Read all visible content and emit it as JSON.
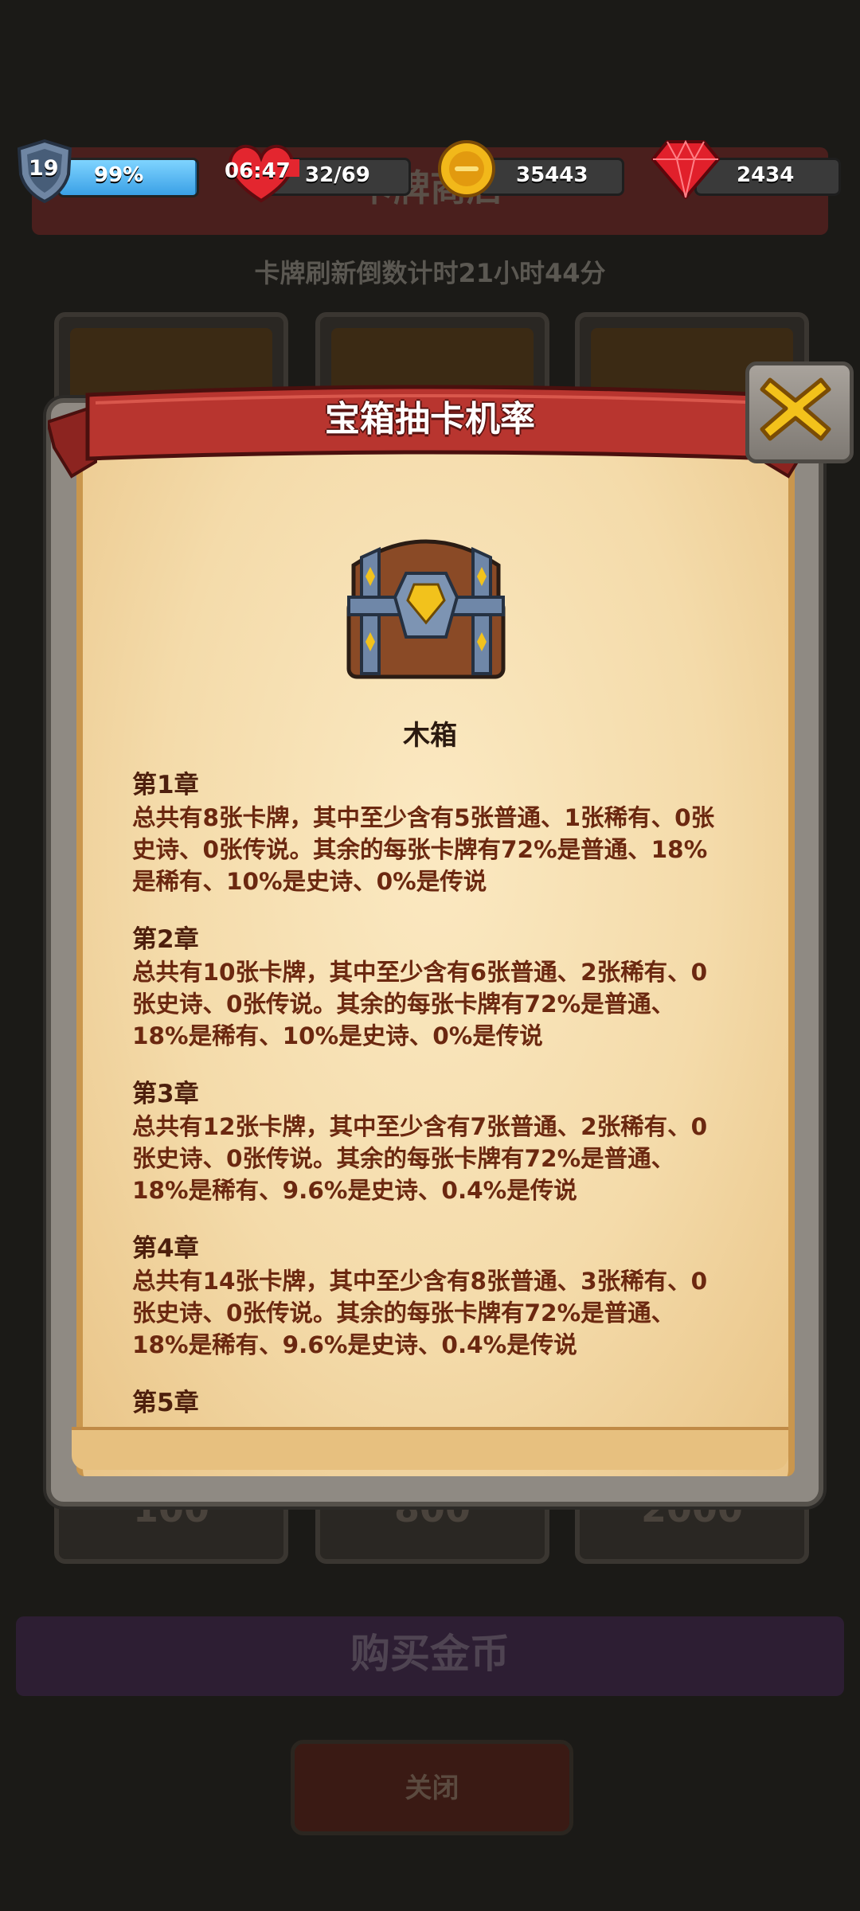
{
  "hud": {
    "level": "19",
    "xp_percent": "99%",
    "xp_fill": 0.99,
    "timer": "06:47",
    "cards": "32/69",
    "coins": "35443",
    "gems": "2434"
  },
  "background": {
    "banner_title": "卡牌商店",
    "countdown": "卡牌刷新倒数计时21小时44分",
    "card_prices": [
      "100",
      "800",
      "2000"
    ],
    "buy_button": "购买金币",
    "close_button": "关闭"
  },
  "dialog": {
    "title": "宝箱抽卡机率",
    "chest_name": "木箱",
    "chapters": [
      {
        "title": "第1章",
        "text": "总共有8张卡牌，其中至少含有5张普通、1张稀有、0张史诗、0张传说。其余的每张卡牌有72%是普通、18%是稀有、10%是史诗、0%是传说"
      },
      {
        "title": "第2章",
        "text": "总共有10张卡牌，其中至少含有6张普通、2张稀有、0张史诗、0张传说。其余的每张卡牌有72%是普通、18%是稀有、10%是史诗、0%是传说"
      },
      {
        "title": "第3章",
        "text": "总共有12张卡牌，其中至少含有7张普通、2张稀有、0张史诗、0张传说。其余的每张卡牌有72%是普通、18%是稀有、9.6%是史诗、0.4%是传说"
      },
      {
        "title": "第4章",
        "text": "总共有14张卡牌，其中至少含有8张普通、3张稀有、0张史诗、0张传说。其余的每张卡牌有72%是普通、18%是稀有、9.6%是史诗、0.4%是传说"
      },
      {
        "title": "第5章",
        "text": ""
      }
    ]
  },
  "colors": {
    "ribbon": "#b8352f",
    "parchment": "#f4dbaa",
    "chapter_text": "#6b2810",
    "close_x": "#f3c21b"
  }
}
